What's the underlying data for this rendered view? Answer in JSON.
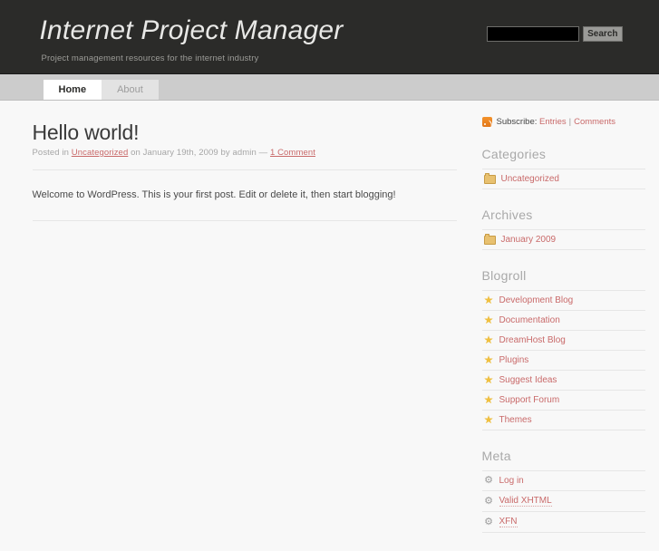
{
  "header": {
    "title": "Internet Project Manager",
    "tagline": "Project management resources for the internet industry",
    "search": {
      "value": "",
      "placeholder": "",
      "button_label": "Search"
    }
  },
  "nav": {
    "tabs": [
      {
        "label": "Home",
        "active": true
      },
      {
        "label": "About",
        "active": false
      }
    ]
  },
  "post": {
    "title": "Hello world!",
    "meta": {
      "posted_in_label": "Posted in",
      "category": "Uncategorized",
      "on_label": "on",
      "date": "January 19th, 2009",
      "by_label": "by",
      "author": "admin",
      "dash": "—",
      "comments": "1 Comment"
    },
    "body": "Welcome to WordPress. This is your first post. Edit or delete it, then start blogging!"
  },
  "sidebar": {
    "subscribe": {
      "icon": "rss-icon",
      "label": "Subscribe:",
      "entries": "Entries",
      "separator": "|",
      "comments": "Comments"
    },
    "widgets": [
      {
        "title": "Categories",
        "items": [
          {
            "label": "Uncategorized",
            "icon": "folder-icon"
          }
        ]
      },
      {
        "title": "Archives",
        "items": [
          {
            "label": "January 2009",
            "icon": "folder-icon"
          }
        ]
      },
      {
        "title": "Blogroll",
        "items": [
          {
            "label": "Development Blog",
            "icon": "star-icon"
          },
          {
            "label": "Documentation",
            "icon": "star-icon"
          },
          {
            "label": "DreamHost Blog",
            "icon": "star-icon"
          },
          {
            "label": "Plugins",
            "icon": "star-icon"
          },
          {
            "label": "Suggest Ideas",
            "icon": "star-icon"
          },
          {
            "label": "Support Forum",
            "icon": "star-icon"
          },
          {
            "label": "Themes",
            "icon": "star-icon"
          }
        ]
      },
      {
        "title": "Meta",
        "items": [
          {
            "label": "Log in",
            "icon": "gear-icon"
          },
          {
            "label": "Valid XHTML",
            "icon": "gear-icon",
            "dotted": true
          },
          {
            "label": "XFN",
            "icon": "gear-icon",
            "dotted": true
          }
        ]
      }
    ]
  },
  "colors": {
    "header_bg": "#2b2b29",
    "nav_bg": "#cccccc",
    "page_bg": "#f8f8f8",
    "link": "#c96a6a",
    "rss_orange": "#e2771a",
    "star_gold": "#f0c040",
    "heading_gray": "#a9a9a9"
  }
}
